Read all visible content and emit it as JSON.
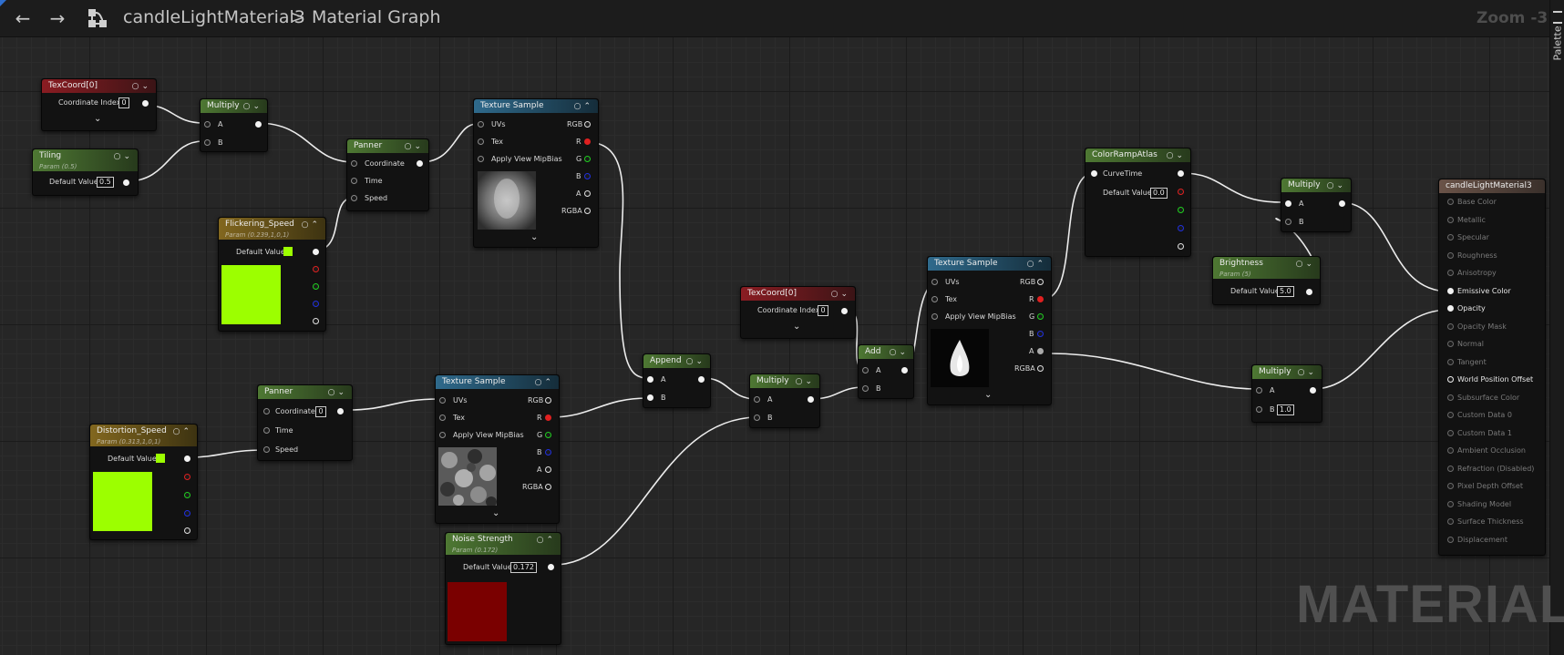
{
  "topbar": {
    "asset_name": "candleLightMaterial3",
    "separator": ">",
    "graph_name": "Material Graph",
    "zoom": "Zoom -3",
    "back_icon": "arrow-left-icon",
    "forward_icon": "arrow-right-icon",
    "graph_icon": "graph-icon"
  },
  "palette": {
    "label": "Palette"
  },
  "watermark": "MATERIAL",
  "nodes": {
    "texcoord1": {
      "title": "TexCoord[0]",
      "row": "Coordinate Index",
      "value": "0"
    },
    "tiling": {
      "title": "Tiling",
      "subtitle": "Param (0.5)",
      "row": "Default Value",
      "value": "0.5"
    },
    "multiply1": {
      "title": "Multiply",
      "a": "A",
      "b": "B"
    },
    "panner1": {
      "title": "Panner",
      "coord": "Coordinate",
      "time": "Time",
      "speed": "Speed"
    },
    "flick": {
      "title": "Flickering_Speed",
      "subtitle": "Param (0.239,1,0,1)",
      "row": "Default Value",
      "color": "#9cff00"
    },
    "tex1": {
      "title": "Texture Sample",
      "uvs": "UVs",
      "tex": "Tex",
      "mip": "Apply View MipBias",
      "out_rgb": "RGB",
      "out_r": "R",
      "out_g": "G",
      "out_b": "B",
      "out_a": "A",
      "out_rgba": "RGBA"
    },
    "append": {
      "title": "Append",
      "a": "A",
      "b": "B"
    },
    "texcoord2": {
      "title": "TexCoord[0]",
      "row": "Coordinate Index",
      "value": "0"
    },
    "multiply2": {
      "title": "Multiply",
      "a": "A",
      "b": "B"
    },
    "add": {
      "title": "Add",
      "a": "A",
      "b": "B"
    },
    "tex3": {
      "title": "Texture Sample",
      "uvs": "UVs",
      "tex": "Tex",
      "mip": "Apply View MipBias",
      "out_rgb": "RGB",
      "out_r": "R",
      "out_g": "G",
      "out_b": "B",
      "out_a": "A",
      "out_rgba": "RGBA"
    },
    "ramp": {
      "title": "ColorRampAtlas",
      "row1": "CurveTime",
      "row2": "Default Value",
      "value": "0.0"
    },
    "multiply3": {
      "title": "Multiply",
      "a": "A",
      "b": "B"
    },
    "bright": {
      "title": "Brightness",
      "subtitle": "Param (5)",
      "row": "Default Value",
      "value": "5.0"
    },
    "multiply4": {
      "title": "Multiply",
      "a": "A",
      "b": "B",
      "bval": "1.0"
    },
    "panner2": {
      "title": "Panner",
      "coord": "Coordinate",
      "coord_val": "0",
      "time": "Time",
      "speed": "Speed"
    },
    "distort": {
      "title": "Distortion_Speed",
      "subtitle": "Param (0.313,1,0,1)",
      "row": "Default Value",
      "color": "#9cff00"
    },
    "tex2": {
      "title": "Texture Sample",
      "uvs": "UVs",
      "tex": "Tex",
      "mip": "Apply View MipBias",
      "out_rgb": "RGB",
      "out_r": "R",
      "out_g": "G",
      "out_b": "B",
      "out_a": "A",
      "out_rgba": "RGBA"
    },
    "noise": {
      "title": "Noise Strength",
      "subtitle": "Param (0.172)",
      "row": "Default Value",
      "value": "0.172",
      "color": "#7a0000"
    }
  },
  "result": {
    "title": "candleLightMaterial3",
    "pins": [
      "Base Color",
      "Metallic",
      "Specular",
      "Roughness",
      "Anisotropy",
      "Emissive Color",
      "Opacity",
      "Opacity Mask",
      "Normal",
      "Tangent",
      "World Position Offset",
      "Subsurface Color",
      "Custom Data 0",
      "Custom Data 1",
      "Ambient Occlusion",
      "Refraction (Disabled)",
      "Pixel Depth Offset",
      "Shading Model",
      "Surface Thickness",
      "Displacement"
    ]
  },
  "colors": {
    "accent_green": "#9cff00",
    "param_red": "#7a0000",
    "header_red": "#8a1c22",
    "header_green": "#4e7833",
    "header_olive": "#82671f",
    "header_blue": "#2f6a8c"
  }
}
